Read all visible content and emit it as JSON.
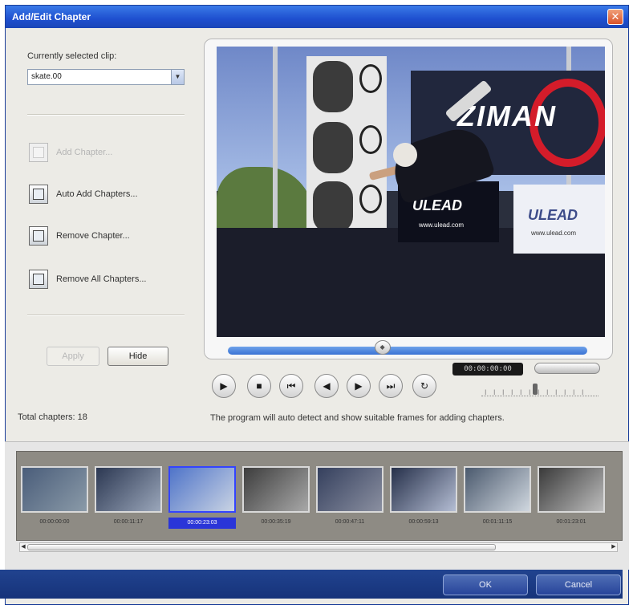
{
  "window": {
    "title": "Add/Edit Chapter",
    "close_glyph": "✕"
  },
  "left_panel": {
    "clip_label": "Currently selected clip:",
    "clip_value": "skate.00",
    "dropdown_arrow": "▼",
    "actions": [
      {
        "label": "Add Chapter...",
        "enabled": false
      },
      {
        "label": "Auto Add Chapters...",
        "enabled": true
      },
      {
        "label": "Remove Chapter...",
        "enabled": true
      },
      {
        "label": "Remove All Chapters...",
        "enabled": true
      }
    ],
    "apply_label": "Apply",
    "hide_label": "Hide",
    "total_chapters": "Total chapters: 18"
  },
  "preview": {
    "timecode": "00:00:00:00",
    "progress_fraction": 0.43,
    "controls": [
      {
        "name": "play",
        "glyph": "▶"
      },
      {
        "name": "stop",
        "glyph": "■"
      },
      {
        "name": "home",
        "glyph": "⏮"
      },
      {
        "name": "prev-frame",
        "glyph": "◀"
      },
      {
        "name": "next-frame",
        "glyph": "▶"
      },
      {
        "name": "end",
        "glyph": "⏭"
      },
      {
        "name": "repeat",
        "glyph": "↻"
      }
    ],
    "jog_ticks": "I I I I I I I I I I I I",
    "video_text": {
      "ziman": "ZIMAN",
      "ulead": "ULEAD",
      "ulead_url": "www.ulead.com",
      "ulead_url2": "www.ulead.com"
    },
    "hint": "The program will auto detect and show suitable frames for adding chapters."
  },
  "filmstrip": {
    "thumbnails": [
      {
        "time": "00:00:00:00",
        "colors": [
          "#4a5d7a",
          "#8a9aa8"
        ]
      },
      {
        "time": "00:00:11:17",
        "colors": [
          "#2c3852",
          "#9aa6ba"
        ]
      },
      {
        "time": "00:00:23:03",
        "colors": [
          "#4f74c9",
          "#c9d3e3"
        ],
        "selected": true
      },
      {
        "time": "00:00:35:19",
        "colors": [
          "#3d3d3d",
          "#a8a8a8"
        ]
      },
      {
        "time": "00:00:47:11",
        "colors": [
          "#35405e",
          "#8a8fa0"
        ]
      },
      {
        "time": "00:00:59:13",
        "colors": [
          "#26304a",
          "#b4bdd3"
        ]
      },
      {
        "time": "00:01:11:15",
        "colors": [
          "#4b5a6e",
          "#d0d7df"
        ]
      },
      {
        "time": "00:01:23:01",
        "colors": [
          "#3a3a3a",
          "#bdbdbd"
        ]
      }
    ],
    "scroll_left": "◀",
    "scroll_right": "▶"
  },
  "footer": {
    "ok_label": "OK",
    "cancel_label": "Cancel"
  }
}
